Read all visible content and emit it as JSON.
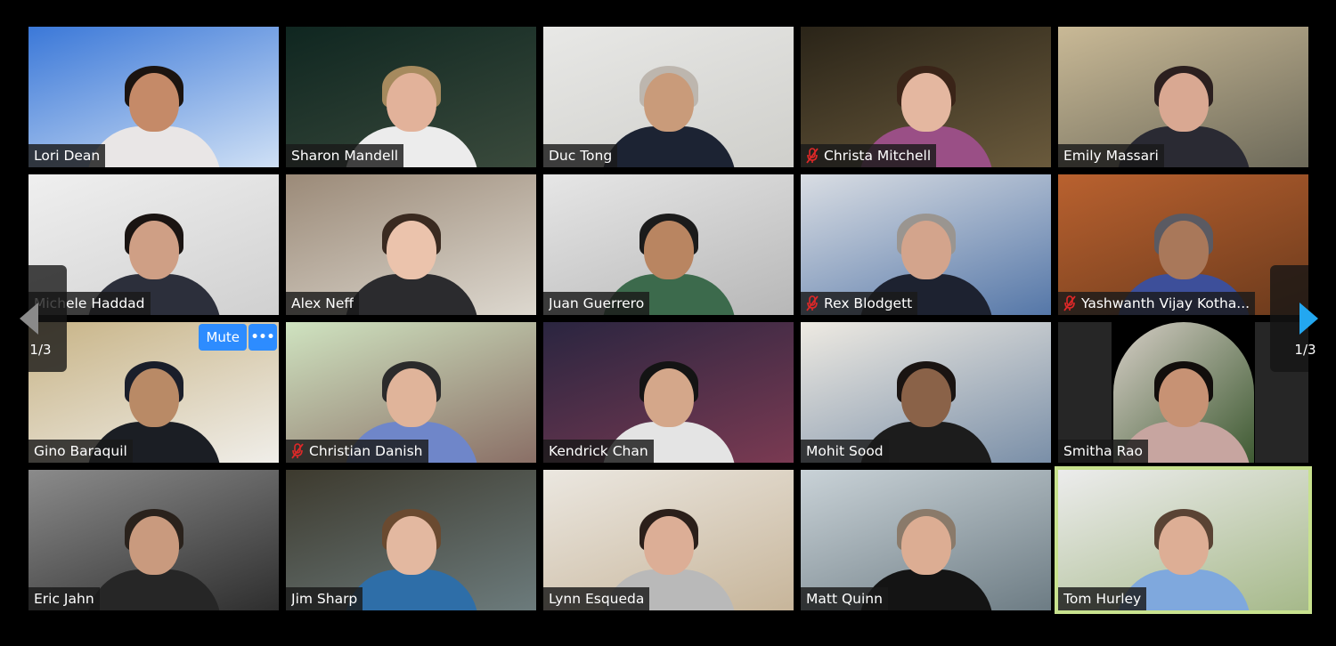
{
  "window": {
    "app": "Zoom Gallery View"
  },
  "pagination": {
    "current_page": 1,
    "total_pages": 3,
    "label_left": "1/3",
    "label_right": "1/3"
  },
  "hover_controls": {
    "mute_label": "Mute",
    "more_label": "•••"
  },
  "colors": {
    "accent": "#2D8CFF",
    "next_arrow": "#23A7F0",
    "prev_arrow": "#8A8A8A",
    "active_speaker_border": "#C8E28E",
    "muted_icon": "#E02828"
  },
  "participants": [
    {
      "name": "Lori Dean",
      "muted": false,
      "bg": [
        "#3b78d8",
        "#cfe0f5"
      ],
      "skin": "#c58a68",
      "hair": "#1b1410",
      "shirt": "#e9e6e6"
    },
    {
      "name": "Sharon Mandell",
      "muted": false,
      "bg": [
        "#0f2620",
        "#3a4a3c"
      ],
      "skin": "#e2b29a",
      "hair": "#a68a5e",
      "shirt": "#ececec"
    },
    {
      "name": "Duc Tong",
      "muted": false,
      "bg": [
        "#e8e8e6",
        "#cfcfcb"
      ],
      "skin": "#c99b7a",
      "hair": "#bdb6ae",
      "shirt": "#1c2333"
    },
    {
      "name": "Christa Mitchell",
      "muted": true,
      "bg": [
        "#2a2418",
        "#6a5a3c"
      ],
      "skin": "#e4b7a0",
      "hair": "#3a2418",
      "shirt": "#9a4f86"
    },
    {
      "name": "Emily Massari",
      "muted": false,
      "bg": [
        "#c9b996",
        "#6d6a5a"
      ],
      "skin": "#d9a892",
      "hair": "#2b1f1f",
      "shirt": "#2a2a33"
    },
    {
      "name": "Michele Haddad",
      "muted": false,
      "bg": [
        "#efefef",
        "#d0d0d0"
      ],
      "skin": "#cf9f85",
      "hair": "#1a1412",
      "shirt": "#2c2f3b"
    },
    {
      "name": "Alex Neff",
      "muted": false,
      "bg": [
        "#9b8a78",
        "#ddd8cf"
      ],
      "skin": "#ebc3ac",
      "hair": "#3a2a20",
      "shirt": "#2b2b2e"
    },
    {
      "name": "Juan Guerrero",
      "muted": false,
      "bg": [
        "#e6e6e6",
        "#b7b7b7"
      ],
      "skin": "#b98561",
      "hair": "#1b1b1b",
      "shirt": "#3c6a4c"
    },
    {
      "name": "Rex Blodgett",
      "muted": true,
      "bg": [
        "#d9dde3",
        "#5577a8"
      ],
      "skin": "#d3a48c",
      "hair": "#9a9590",
      "shirt": "#1d2230"
    },
    {
      "name": "Yashwanth Vijay Kotha...",
      "muted": true,
      "bg": [
        "#b9612f",
        "#6b3a1c"
      ],
      "skin": "#a9785a",
      "hair": "#5a5a62",
      "shirt": "#3d4f9a"
    },
    {
      "name": "Gino Baraquil",
      "muted": false,
      "bg": [
        "#c8b487",
        "#f0eee9"
      ],
      "skin": "#b98a66",
      "hair": "#1a1e2a",
      "shirt": "#1b1e24",
      "hover": true
    },
    {
      "name": "Christian Danish",
      "muted": true,
      "bg": [
        "#cfe3c0",
        "#8a6f66"
      ],
      "skin": "#e0b49a",
      "hair": "#2b2b2b",
      "shirt": "#6f86c9"
    },
    {
      "name": "Kendrick Chan",
      "muted": false,
      "bg": [
        "#2a2540",
        "#7a3a52"
      ],
      "skin": "#d4a78a",
      "hair": "#141414",
      "shirt": "#e4e4e4"
    },
    {
      "name": "Mohit Sood",
      "muted": false,
      "bg": [
        "#eeeae2",
        "#7a8fa8"
      ],
      "skin": "#8a6248",
      "hair": "#1a1412",
      "shirt": "#1c1c1c"
    },
    {
      "name": "Smitha Rao",
      "muted": false,
      "profile_photo": true,
      "bg": [
        "#d7cfc7",
        "#3e5a32"
      ],
      "skin": "#c79274",
      "hair": "#120e0c",
      "shirt": "#c7a5a0"
    },
    {
      "name": "Eric Jahn",
      "muted": false,
      "bg": [
        "#8b8b8b",
        "#2e2e2e"
      ],
      "skin": "#c99a7e",
      "hair": "#2a221c",
      "shirt": "#262626"
    },
    {
      "name": "Jim Sharp",
      "muted": false,
      "bg": [
        "#3d3a2e",
        "#6c7b7c"
      ],
      "skin": "#e3b8a0",
      "hair": "#6a4a30",
      "shirt": "#2e6ea8"
    },
    {
      "name": "Lynn Esqueda",
      "muted": false,
      "bg": [
        "#ebe7e0",
        "#c7b59a"
      ],
      "skin": "#dcae96",
      "hair": "#2b1f1a",
      "shirt": "#b9b9b9"
    },
    {
      "name": "Matt Quinn",
      "muted": false,
      "bg": [
        "#c9d2d7",
        "#6d7c84"
      ],
      "skin": "#dcad93",
      "hair": "#8a7a6a",
      "shirt": "#141414"
    },
    {
      "name": "Tom Hurley",
      "muted": false,
      "active_speaker": true,
      "bg": [
        "#ececec",
        "#a6b98a"
      ],
      "skin": "#ddae95",
      "hair": "#5a4334",
      "shirt": "#7fa8dd"
    }
  ]
}
